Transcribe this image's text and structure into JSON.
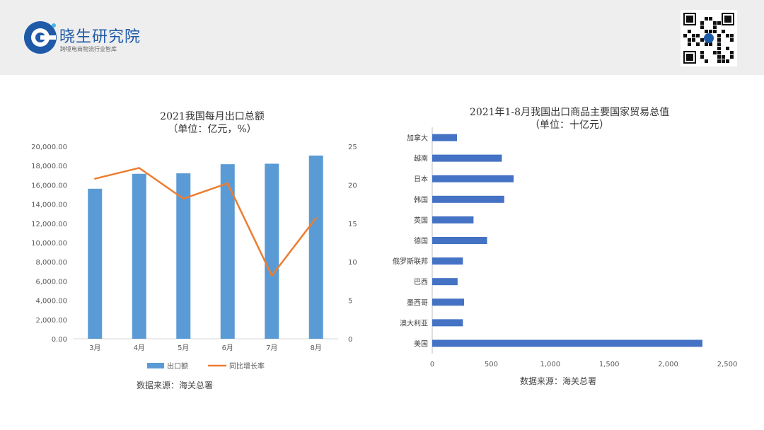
{
  "header": {
    "brand_name": "晓生研究院",
    "brand_tagline": "跨境电商物流行业智库",
    "brand_color": "#1e5aa8"
  },
  "left_chart_source": "数据来源：海关总署",
  "right_chart_source": "数据来源：海关总署",
  "chart_data": [
    {
      "type": "bar",
      "title": "2021我国每月出口总额",
      "subtitle": "（单位：亿元，%）",
      "categories": [
        "3月",
        "4月",
        "5月",
        "6月",
        "7月",
        "8月"
      ],
      "series": [
        {
          "name": "出口额",
          "type": "bar",
          "axis": "left",
          "color": "#5b9bd5",
          "values": [
            15600,
            17150,
            17200,
            18150,
            18200,
            19050
          ]
        },
        {
          "name": "同比增长率",
          "type": "line",
          "axis": "right",
          "color": "#ed7d31",
          "values": [
            20.8,
            22.2,
            18.2,
            20.2,
            8.2,
            15.7
          ]
        }
      ],
      "ylim": [
        0,
        20000
      ],
      "y_ticks": [
        "0.00",
        "2,000.00",
        "4,000.00",
        "6,000.00",
        "8,000.00",
        "10,000.00",
        "12,000.00",
        "14,000.00",
        "16,000.00",
        "18,000.00",
        "20,000.00"
      ],
      "y2lim": [
        0,
        25
      ],
      "y2_ticks": [
        "0",
        "5",
        "10",
        "15",
        "20",
        "25"
      ],
      "grid": false,
      "legend": "bottom"
    },
    {
      "type": "bar",
      "orientation": "horizontal",
      "title": "2021年1-8月我国出口商品主要国家贸易总值",
      "subtitle": "（单位：十亿元）",
      "categories": [
        "加拿大",
        "越南",
        "日本",
        "韩国",
        "英国",
        "德国",
        "俄罗斯联邦",
        "巴西",
        "墨西哥",
        "澳大利亚",
        "美国"
      ],
      "values": [
        210,
        590,
        690,
        610,
        350,
        465,
        260,
        215,
        270,
        260,
        2290
      ],
      "color": "#4472c4",
      "xlim": [
        0,
        2500
      ],
      "x_ticks": [
        "0",
        "500",
        "1,000",
        "1,500",
        "2,000",
        "2,500"
      ],
      "grid": false,
      "legend": "none"
    }
  ]
}
